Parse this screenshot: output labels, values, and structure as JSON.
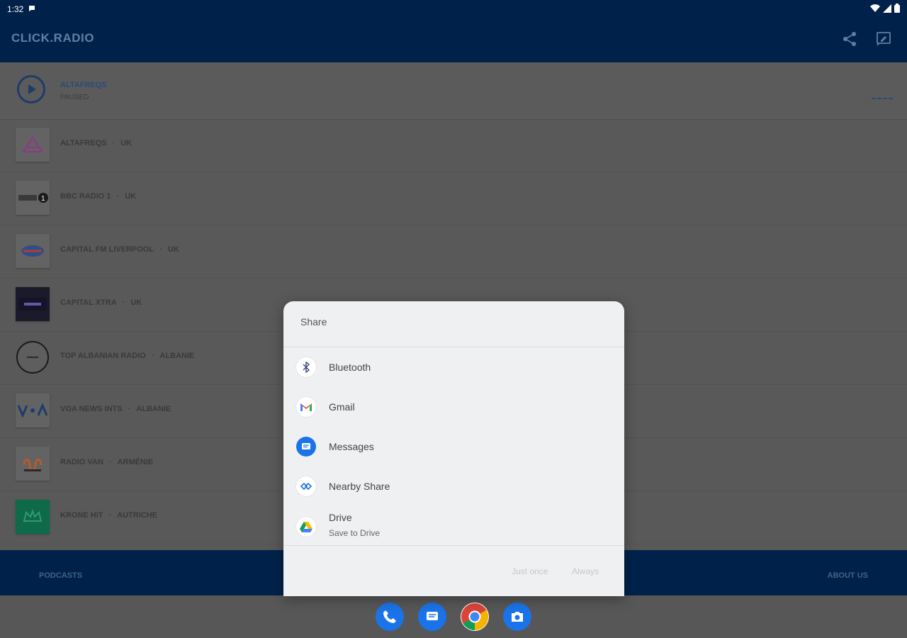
{
  "status": {
    "time": "1:32"
  },
  "app": {
    "title": "CLICK.RADIO"
  },
  "now_playing": {
    "title": "ALTAFREQS",
    "status": "PAUSED"
  },
  "stations": [
    {
      "name": "ALTAFREQS",
      "country": "UK"
    },
    {
      "name": "BBC RADIO 1",
      "country": "UK"
    },
    {
      "name": "CAPITAL FM LIVERPOOL",
      "country": "UK"
    },
    {
      "name": "CAPITAL XTRA",
      "country": "UK"
    },
    {
      "name": "TOP ALBANIAN RADIO",
      "country": "ALBANIE"
    },
    {
      "name": "VOA NEWS INTS",
      "country": "ALBANIE"
    },
    {
      "name": "RADIO VAN",
      "country": "ARMÉNIE"
    },
    {
      "name": "KRONE HIT",
      "country": "AUTRICHE"
    }
  ],
  "bottom_bar": {
    "podcasts": "PODCASTS",
    "about": "ABOUT US"
  },
  "share_dialog": {
    "title": "Share",
    "items": [
      {
        "label": "Bluetooth"
      },
      {
        "label": "Gmail"
      },
      {
        "label": "Messages"
      },
      {
        "label": "Nearby Share"
      },
      {
        "label": "Drive",
        "sublabel": "Save to Drive"
      }
    ],
    "just_once": "Just once",
    "always": "Always"
  },
  "colors": {
    "appbar": "#00224a",
    "accent": "#2c4a78",
    "dialog_bg": "#eff0f2"
  },
  "icons": {
    "appbar": [
      "share-icon",
      "feedback-icon"
    ],
    "dock": [
      "phone-icon",
      "messages-icon",
      "chrome-icon",
      "camera-icon"
    ]
  }
}
